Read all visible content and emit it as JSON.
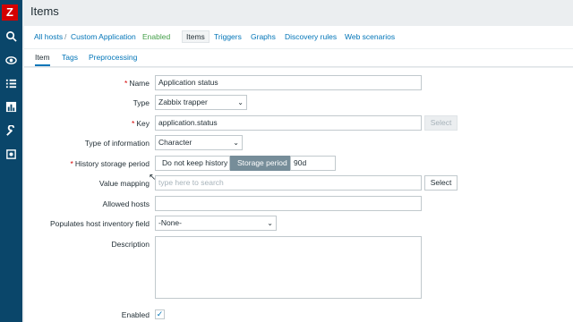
{
  "sidebar": {
    "logo": "Z",
    "icons": [
      "search-icon",
      "eye-icon",
      "list-icon",
      "bar-chart-icon",
      "wrench-icon",
      "gear-icon"
    ]
  },
  "page": {
    "title": "Items"
  },
  "navbar": {
    "all_hosts": "All hosts",
    "separator": "/",
    "host": "Custom Application",
    "status": "Enabled",
    "items": "Items",
    "triggers": "Triggers",
    "graphs": "Graphs",
    "discovery": "Discovery rules",
    "web": "Web scenarios"
  },
  "tabs": {
    "item": "Item",
    "tags": "Tags",
    "preprocessing": "Preprocessing"
  },
  "form": {
    "name_label": "Name",
    "name_value": "Application status",
    "type_label": "Type",
    "type_value": "Zabbix trapper",
    "key_label": "Key",
    "key_value": "application.status",
    "key_select": "Select",
    "info_type_label": "Type of information",
    "info_type_value": "Character",
    "history_label": "History storage period",
    "history_opt1": "Do not keep history",
    "history_opt2": "Storage period",
    "history_value": "90d",
    "value_mapping_label": "Value mapping",
    "value_mapping_placeholder": "type here to search",
    "value_mapping_select": "Select",
    "allowed_hosts_label": "Allowed hosts",
    "allowed_hosts_value": "",
    "inventory_label": "Populates host inventory field",
    "inventory_value": "-None-",
    "description_label": "Description",
    "enabled_label": "Enabled",
    "enabled_checked": true,
    "required_mark": "*"
  },
  "colors": {
    "sidebar": "#0a466a",
    "brand": "#d40000",
    "link": "#0275b8",
    "enabled": "#429e47"
  }
}
